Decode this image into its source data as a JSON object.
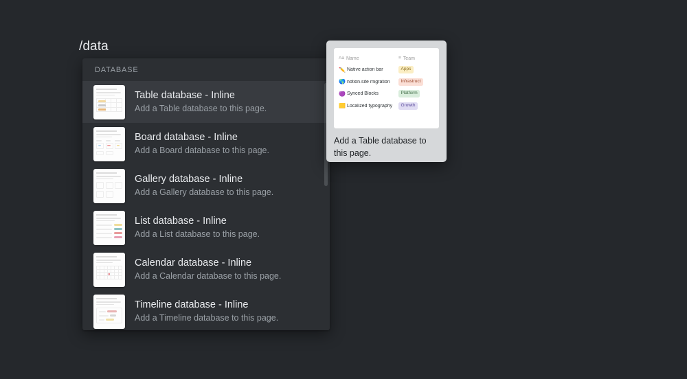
{
  "colors": {
    "page_background": "#25282c",
    "menu_background": "#2c2f33",
    "menu_selected": "#383b40",
    "text_primary": "#e8eaed",
    "text_secondary": "#9aa0a6",
    "preview_card_background": "#d6d8da",
    "preview_surface": "#ffffff"
  },
  "slash_query": "/data",
  "menu": {
    "section_label": "DATABASE",
    "items": [
      {
        "title": "Table database - Inline",
        "description": "Add a Table database to this page.",
        "icon": "table-database-thumbnail",
        "selected": true
      },
      {
        "title": "Board database - Inline",
        "description": "Add a Board database to this page.",
        "icon": "board-database-thumbnail",
        "selected": false
      },
      {
        "title": "Gallery database - Inline",
        "description": "Add a Gallery database to this page.",
        "icon": "gallery-database-thumbnail",
        "selected": false
      },
      {
        "title": "List database - Inline",
        "description": "Add a List database to this page.",
        "icon": "list-database-thumbnail",
        "selected": false
      },
      {
        "title": "Calendar database - Inline",
        "description": "Add a Calendar database to this page.",
        "icon": "calendar-database-thumbnail",
        "selected": false
      },
      {
        "title": "Timeline database - Inline",
        "description": "Add a Timeline database to this page.",
        "icon": "timeline-database-thumbnail",
        "selected": false
      }
    ]
  },
  "preview": {
    "caption": "Add a Table database to this page.",
    "table": {
      "columns": [
        {
          "icon_glyph": "Aa",
          "icon_name": "text-property-icon",
          "label": "Name"
        },
        {
          "icon_glyph": "≡",
          "icon_name": "select-property-icon",
          "label": "Team"
        }
      ],
      "rows": [
        {
          "emoji": "✏️",
          "emoji_name": "pencil-emoji",
          "name": "Native action bar",
          "team": "Apps",
          "team_bg": "#fbeec4",
          "team_fg": "#8a6d20"
        },
        {
          "emoji": "🌎",
          "emoji_name": "globe-emoji",
          "name": "notion.site migration",
          "team": "Infrastruct",
          "team_bg": "#fbdfd6",
          "team_fg": "#9a4a2e"
        },
        {
          "emoji": "🟣",
          "emoji_name": "purple-circle-emoji",
          "name": "Synced Blocks",
          "team": "Platform",
          "team_bg": "#d9eddc",
          "team_fg": "#3f6b46"
        },
        {
          "emoji": "🟨",
          "emoji_name": "orange-square-emoji",
          "name": "Localized typography",
          "team": "Growth",
          "team_bg": "#e0dcf3",
          "team_fg": "#5a4a9c"
        }
      ]
    }
  }
}
